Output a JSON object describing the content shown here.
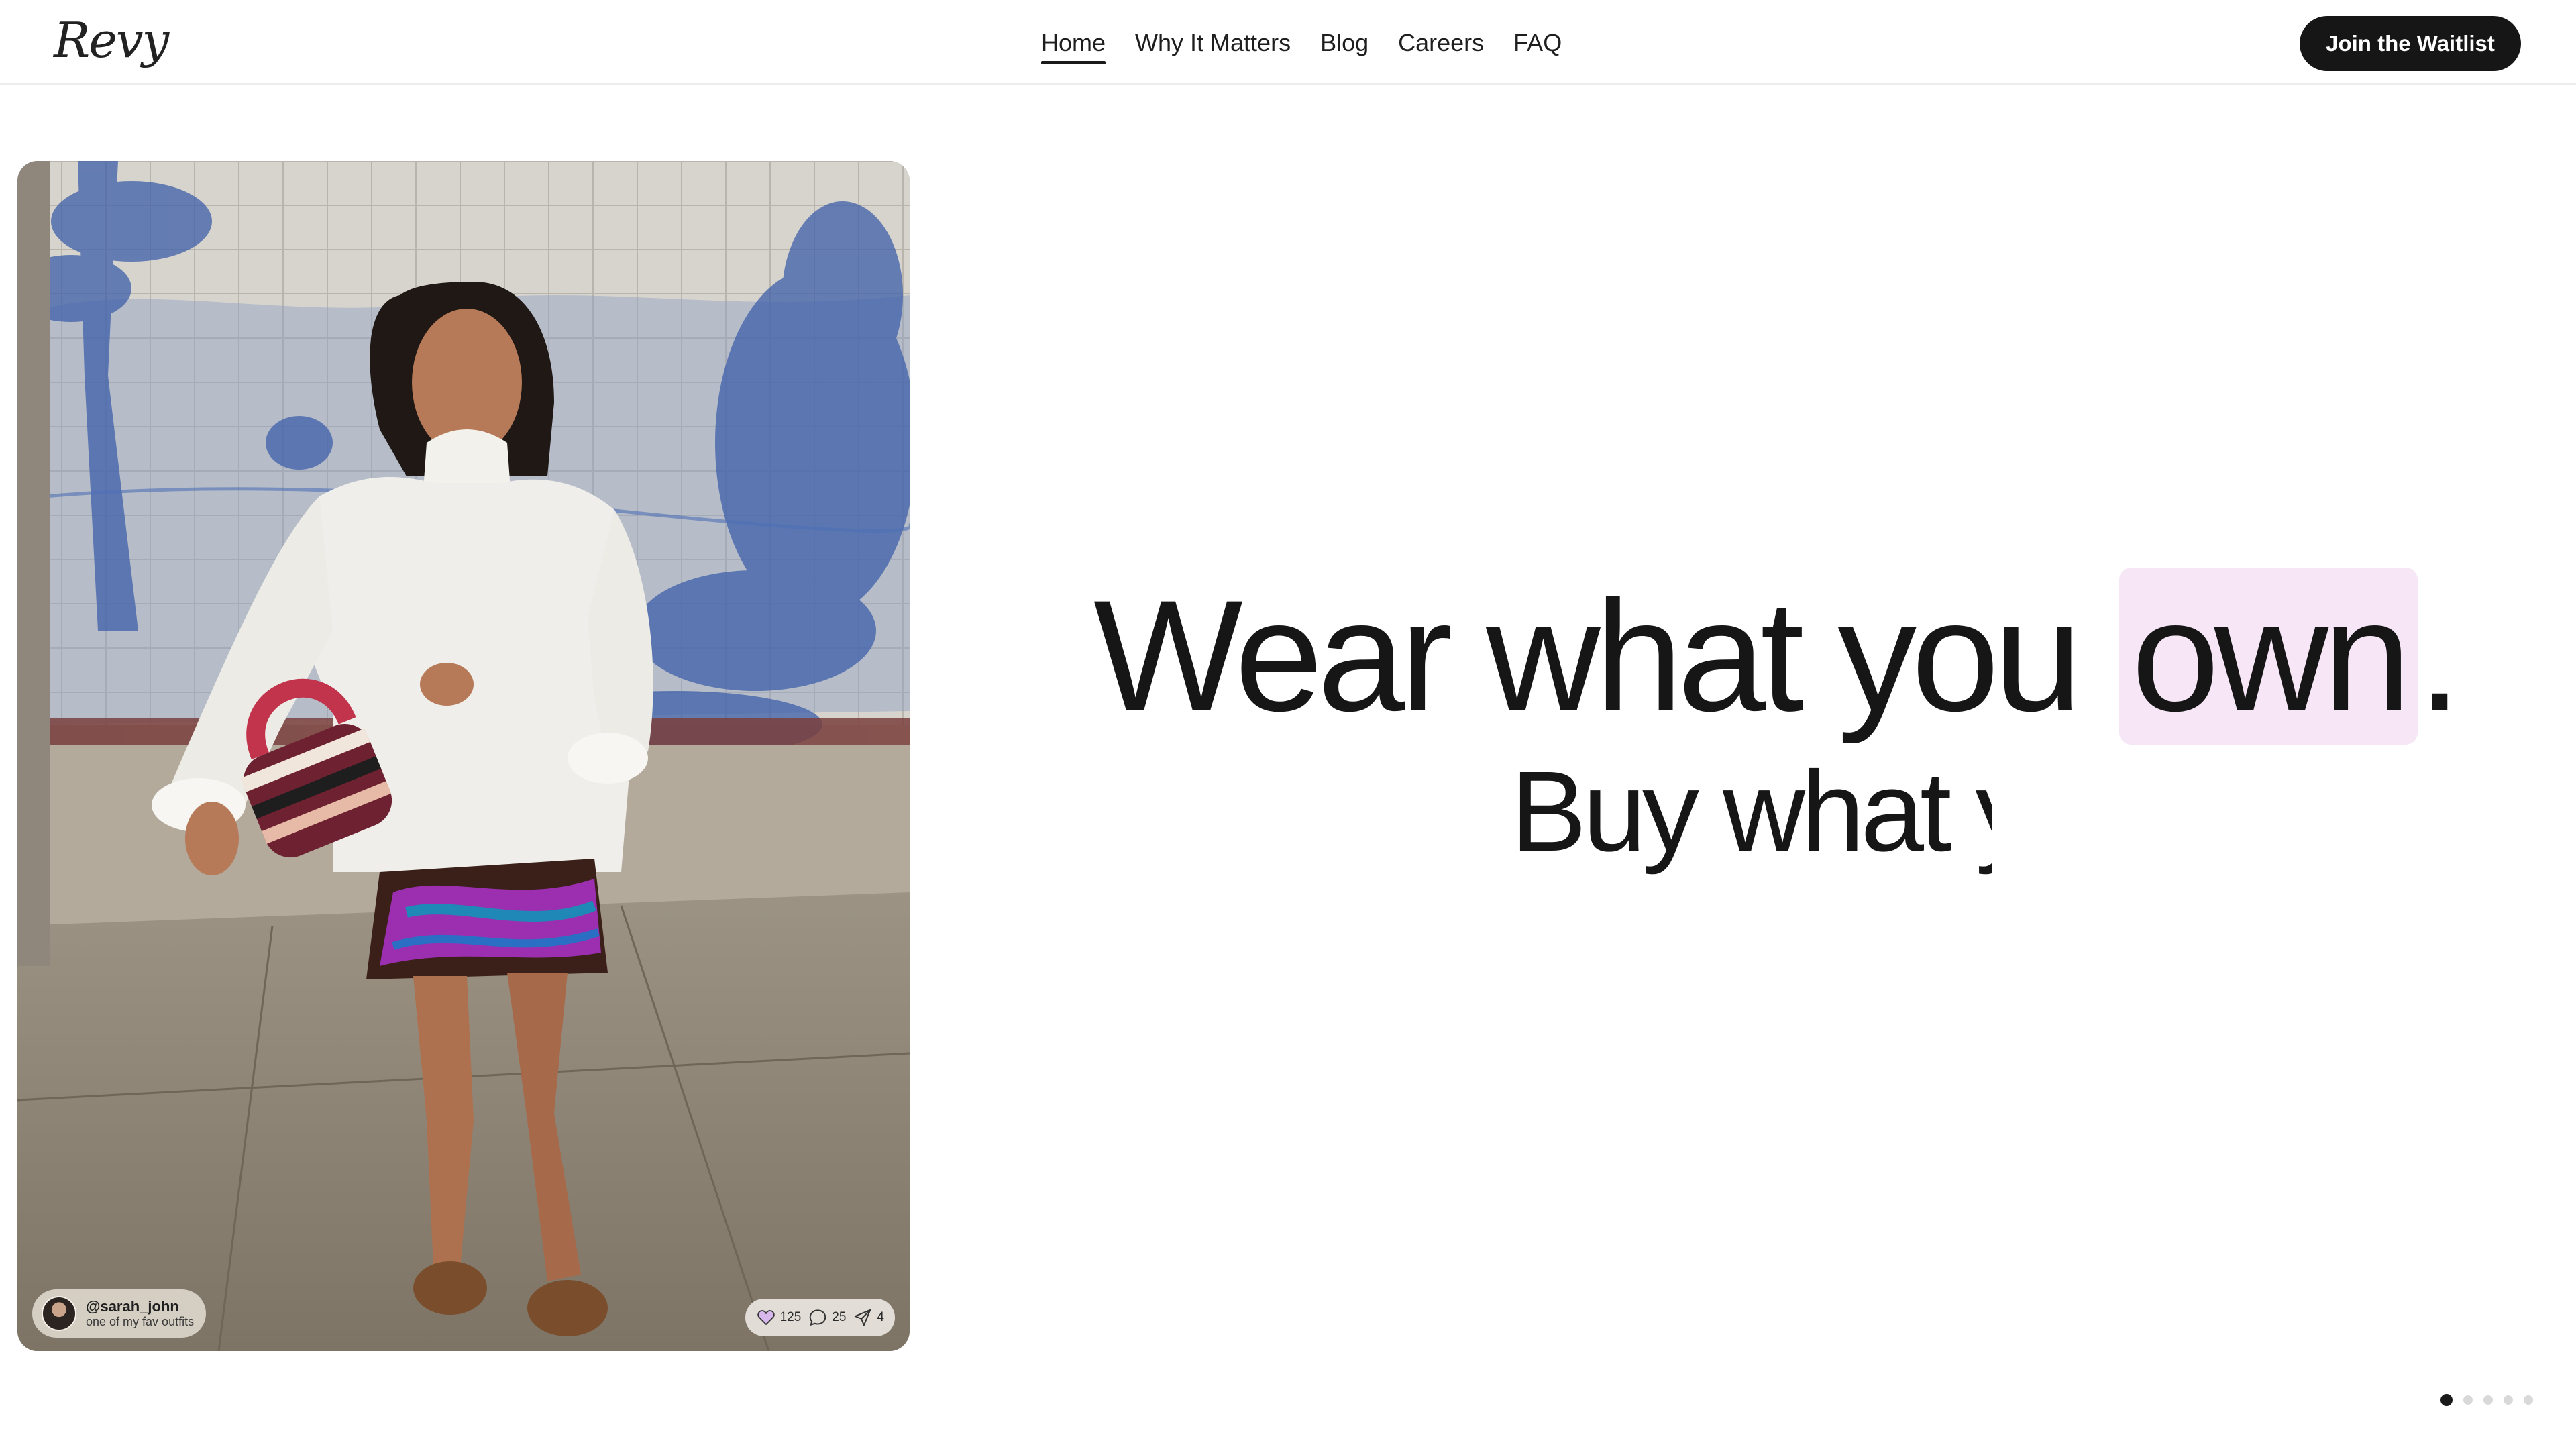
{
  "brand": {
    "logo_text": "Revy"
  },
  "nav": {
    "items": [
      {
        "label": "Home",
        "active": true
      },
      {
        "label": "Why It Matters",
        "active": false
      },
      {
        "label": "Blog",
        "active": false
      },
      {
        "label": "Careers",
        "active": false
      },
      {
        "label": "FAQ",
        "active": false
      }
    ]
  },
  "header": {
    "cta_label": "Join the Waitlist"
  },
  "post": {
    "username": "@sarah_john",
    "caption": "one of my fav outfits",
    "likes": "125",
    "comments": "25",
    "shares": "4"
  },
  "hero": {
    "line1_prefix": "Wear what you",
    "line1_highlight": "own",
    "line1_suffix": ".",
    "line2": "Buy what y"
  },
  "carousel": {
    "total": 5,
    "active_index": 0
  },
  "colors": {
    "accent_dark": "#161616",
    "highlight": "#f6e6f6",
    "dot_inactive": "#d9d9d9"
  }
}
